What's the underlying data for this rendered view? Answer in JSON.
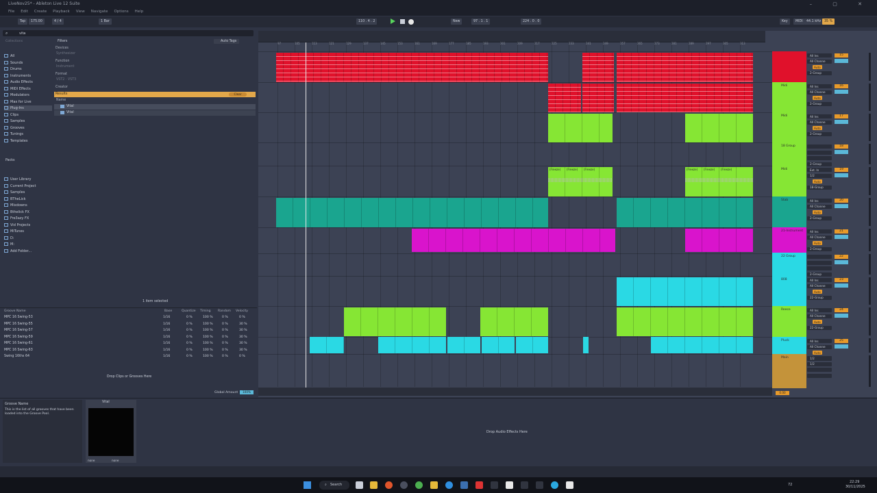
{
  "app": {
    "title": "LiveNov25* - Ableton Live 12 Suite"
  },
  "menu": [
    "File",
    "Edit",
    "Create",
    "Playback",
    "View",
    "Navigate",
    "Options",
    "Help"
  ],
  "transport": {
    "tap": "Tap",
    "tempo": "175.00",
    "meter": "4 / 4",
    "quantize": "1 Bar",
    "position": "110 . 4 . 2",
    "arr_pos": "97 . 1 . 1",
    "loop_len": "224 . 0 . 0",
    "mode": "New",
    "key": "Key",
    "midi": "MIDI",
    "sample_rate": "44.1 kHz",
    "cpu": "35 %"
  },
  "browser": {
    "search_text": "vita",
    "collections_label": "Collections",
    "categories": [
      "All",
      "Sounds",
      "Drums",
      "Instruments",
      "Audio Effects",
      "MIDI Effects",
      "Modulators",
      "Max for Live",
      "Plug-Ins",
      "Clips",
      "Samples",
      "Grooves",
      "Tunings",
      "Templates"
    ],
    "places_label": "Packs",
    "places": [
      "User Library",
      "Current Project",
      "Samples",
      "BTheLick",
      "Mixdowns",
      "Bthelick FX",
      "Fre3azy FX",
      "Vid Projects",
      "MiTunes",
      "D:",
      "M:",
      "Add Folder..."
    ],
    "filters_label": "Filters",
    "auto_tags": "Auto Tags",
    "filter_groups": [
      "Devices",
      "Function",
      "Format",
      "Creator"
    ],
    "devices_value": "Synthesizer",
    "function_value": "Instrument",
    "format_value": "VST2 · VST3",
    "results_label": "Results",
    "clear_label": "Clear",
    "name_col": "Name",
    "results": [
      "Vital",
      "Vital"
    ],
    "selection_status": "1 item selected"
  },
  "groove_pool": {
    "columns": [
      "Groove Name",
      "Base",
      "Quantize",
      "Timing",
      "Random",
      "Velocity"
    ],
    "rows": [
      {
        "name": "MPC 16 Swing-53",
        "base": "1/16",
        "quantize": "0 %",
        "timing": "100 %",
        "random": "0 %",
        "velocity": "0 %"
      },
      {
        "name": "MPC 16 Swing-55",
        "base": "1/16",
        "quantize": "0 %",
        "timing": "100 %",
        "random": "0 %",
        "velocity": "30 %"
      },
      {
        "name": "MPC 16 Swing-57",
        "base": "1/16",
        "quantize": "0 %",
        "timing": "100 %",
        "random": "0 %",
        "velocity": "30 %"
      },
      {
        "name": "MPC 16 Swing-59",
        "base": "1/16",
        "quantize": "0 %",
        "timing": "100 %",
        "random": "0 %",
        "velocity": "30 %"
      },
      {
        "name": "MPC 16 Swing-61",
        "base": "1/16",
        "quantize": "0 %",
        "timing": "100 %",
        "random": "0 %",
        "velocity": "30 %"
      },
      {
        "name": "MPC 16 Swing-63",
        "base": "1/16",
        "quantize": "0 %",
        "timing": "100 %",
        "random": "0 %",
        "velocity": "30 %"
      },
      {
        "name": "Swing 16ths 64",
        "base": "1/16",
        "quantize": "0 %",
        "timing": "100 %",
        "random": "0 %",
        "velocity": "0 %"
      }
    ],
    "drop_hint": "Drop Clips or Grooves Here",
    "global_amount_label": "Global Amount",
    "global_amount": "100%"
  },
  "info": {
    "title": "Groove Name",
    "text": "This is the list of all grooves that have been loaded into the Groove Pool."
  },
  "device": {
    "name": "Vital",
    "chain_a": "none",
    "chain_b": "none"
  },
  "detail": {
    "drop_hint": "Drop Audio Effects Here"
  },
  "timeline_marks": [
    "97",
    "105",
    "113",
    "121",
    "129",
    "137",
    "145",
    "153",
    "161",
    "169",
    "177",
    "185",
    "193",
    "201",
    "209",
    "217",
    "225",
    "233",
    "241",
    "249",
    "257",
    "265",
    "273",
    "281",
    "289",
    "297",
    "305",
    "313"
  ],
  "tracks": [
    {
      "name": "",
      "color": "#e0112b",
      "num": "15",
      "input": "All Ins",
      "channel": "All Channe",
      "monitor": "Auto",
      "out": "2-Group"
    },
    {
      "name": "Midi",
      "color": "#86e634",
      "num": "16",
      "input": "All Ins",
      "channel": "All Channe",
      "monitor": "Auto",
      "out": "2-Group"
    },
    {
      "name": "Midi",
      "color": "#86e634",
      "num": "17",
      "input": "All Ins",
      "channel": "All Channe",
      "monitor": "Auto",
      "out": "2-Group"
    },
    {
      "name": "18 Group",
      "color": "#86e634",
      "num": "18",
      "input": "",
      "channel": "",
      "monitor": "",
      "out": "2-Group"
    },
    {
      "name": "Midi",
      "color": "#86e634",
      "num": "19",
      "input": "Ext. In",
      "channel": "1/2",
      "monitor": "Auto",
      "out": "18-Group"
    },
    {
      "name": "Stab",
      "color": "#1aa58f",
      "num": "20",
      "input": "All Ins",
      "channel": "All Channe",
      "monitor": "Auto",
      "out": "2-Group"
    },
    {
      "name": "21-Instrument",
      "color": "#d914cc",
      "num": "21",
      "input": "All Ins",
      "channel": "All Channe",
      "monitor": "Auto",
      "out": "2-Group"
    },
    {
      "name": "22 Group",
      "color": "#2ad9e4",
      "num": "22",
      "input": "",
      "channel": "",
      "monitor": "",
      "out": "2-Group"
    },
    {
      "name": "808",
      "color": "#2ad9e4",
      "num": "23",
      "input": "All Ins",
      "channel": "All Channe",
      "monitor": "Auto",
      "out": "22-Group"
    },
    {
      "name": "Reece",
      "color": "#86e634",
      "num": "24",
      "input": "All Ins",
      "channel": "All Channe",
      "monitor": "Auto",
      "out": "22-Group"
    },
    {
      "name": "Pluck",
      "color": "#2ad9e4",
      "num": "25",
      "input": "All Ins",
      "channel": "All Channe",
      "monitor": "Auto",
      "out": "22-Group"
    },
    {
      "name": "Main",
      "color": "#c4933a",
      "num": "",
      "input": "1/2",
      "channel": "1/2",
      "monitor": "",
      "out": ""
    }
  ],
  "freeze_label": "(Freeze)",
  "main_volume": "0.00",
  "taskbar": {
    "search": "Search",
    "time": "22:29",
    "date": "30/11/2025",
    "temp": "72"
  }
}
